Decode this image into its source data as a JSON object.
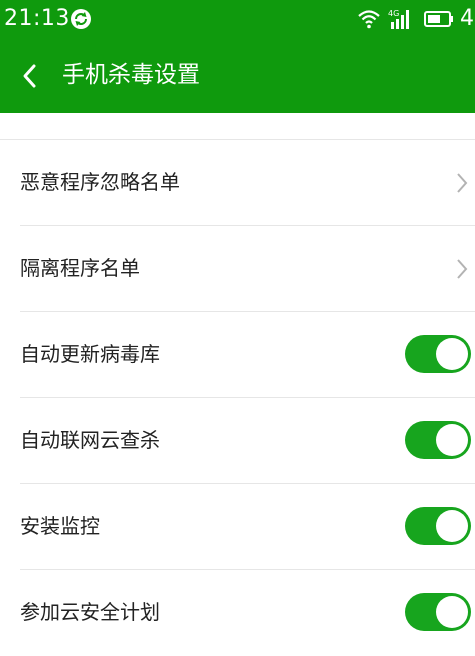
{
  "status_bar": {
    "time": "21:13",
    "battery_text": "4",
    "network_label": "4G"
  },
  "header": {
    "title": "手机杀毒设置"
  },
  "settings": {
    "items": [
      {
        "label": "恶意程序忽略名单",
        "control": "chevron"
      },
      {
        "label": "隔离程序名单",
        "control": "chevron"
      },
      {
        "label": "自动更新病毒库",
        "control": "toggle",
        "enabled": true
      },
      {
        "label": "自动联网云查杀",
        "control": "toggle",
        "enabled": true
      },
      {
        "label": "安装监控",
        "control": "toggle",
        "enabled": true
      },
      {
        "label": "参加云安全计划",
        "control": "toggle",
        "enabled": true
      }
    ]
  },
  "colors": {
    "brand_green": "#0f9a0d",
    "toggle_on": "#17a51e",
    "divider": "#e6e6e6"
  },
  "icons": [
    "sync-icon",
    "wifi-icon",
    "signal-icon",
    "battery-icon",
    "back-icon",
    "chevron-right-icon"
  ]
}
